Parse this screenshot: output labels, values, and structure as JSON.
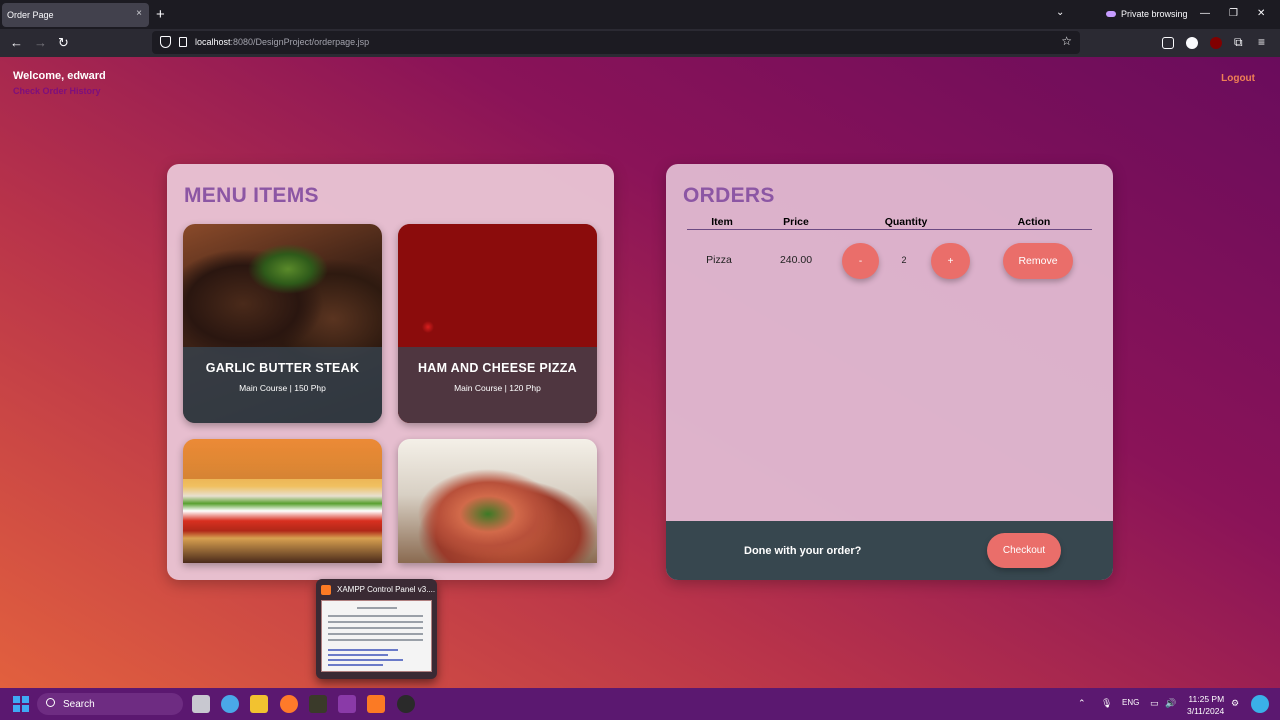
{
  "browser": {
    "tab_title": "Order Page",
    "tab_close": "×",
    "new_tab": "+",
    "private_label": "Private browsing",
    "url_host": "localhost",
    "url_rest": ":8080/DesignProject/orderpage.jsp"
  },
  "header": {
    "welcome": "Welcome, edward",
    "history_link": "Check Order History",
    "logout": "Logout"
  },
  "menu": {
    "title": "MENU ITEMS",
    "items": [
      {
        "name": "GARLIC BUTTER STEAK",
        "desc": "Main Course | 150 Php"
      },
      {
        "name": "HAM AND CHEESE PIZZA",
        "desc": "Main Course | 120 Php"
      },
      {
        "name": "",
        "desc": ""
      },
      {
        "name": "",
        "desc": ""
      }
    ]
  },
  "orders": {
    "title": "ORDERS",
    "columns": [
      "Item",
      "Price",
      "Quantity",
      "Action"
    ],
    "rows": [
      {
        "item": "Pizza",
        "price": "240.00",
        "quantity": "2",
        "minus": "-",
        "plus": "+",
        "remove": "Remove"
      }
    ],
    "footer_text": "Done with your order?",
    "checkout": "Checkout"
  },
  "thumbnail": {
    "title": "XAMPP Control Panel v3...."
  },
  "taskbar": {
    "search": "Search",
    "lang": "ENG",
    "time": "11:25 PM",
    "date": "3/11/2024"
  },
  "colors": {
    "accent_purple": "#8c56a4",
    "button": "#ea6e6a",
    "footer_bg": "#37474f"
  }
}
